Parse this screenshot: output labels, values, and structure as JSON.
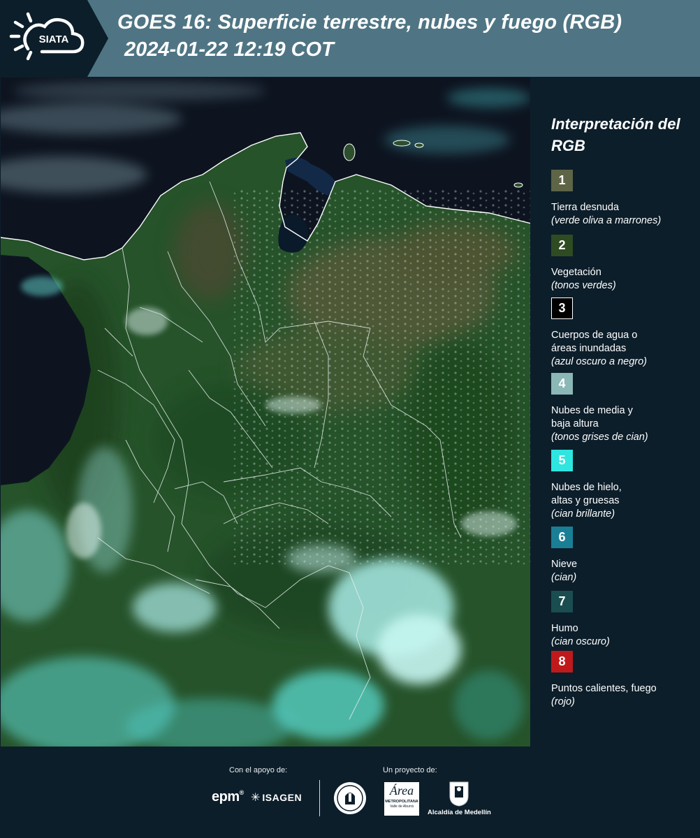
{
  "header": {
    "brand": "SIATA",
    "title_line1": "GOES 16: Superficie terrestre, nubes y fuego (RGB)",
    "title_line2": "2024-01-22 12:19 COT"
  },
  "legend": {
    "title": "Interpretación del RGB",
    "items": [
      {
        "num": "1",
        "label": "Tierra desnuda",
        "desc": "(verde oliva a marrones)",
        "color": "#5e6446"
      },
      {
        "num": "2",
        "label": "Vegetación",
        "desc": "(tonos verdes)",
        "color": "#2f4b22"
      },
      {
        "num": "3",
        "label": "Cuerpos de agua o\náreas inundadas",
        "desc": "(azul oscuro a negro)",
        "color": "#000000"
      },
      {
        "num": "4",
        "label": "Nubes de media y\nbaja altura",
        "desc": "(tonos grises de cian)",
        "color": "#8bb7b6"
      },
      {
        "num": "5",
        "label": "Nubes de hielo,\naltas y gruesas",
        "desc": "(cian brillante)",
        "color": "#2ee5e0"
      },
      {
        "num": "6",
        "label": "Nieve",
        "desc": "(cian)",
        "color": "#1a7f95"
      },
      {
        "num": "7",
        "label": "Humo",
        "desc": "(cian oscuro)",
        "color": "#1a4d50"
      },
      {
        "num": "8",
        "label": "Puntos calientes, fuego",
        "desc": "(rojo)",
        "color": "#c0191c"
      }
    ]
  },
  "footer": {
    "support_caption": "Con el apoyo de:",
    "project_caption": "Un proyecto de:",
    "epm_logo": "epm",
    "isagen_logo": "ISAGEN",
    "area_logo_line1": "Área",
    "area_logo_line2": "METROPOLITANA",
    "area_logo_line3": "Valle de Aburrá",
    "alcaldia_logo": "Alcaldía de Medellín"
  }
}
